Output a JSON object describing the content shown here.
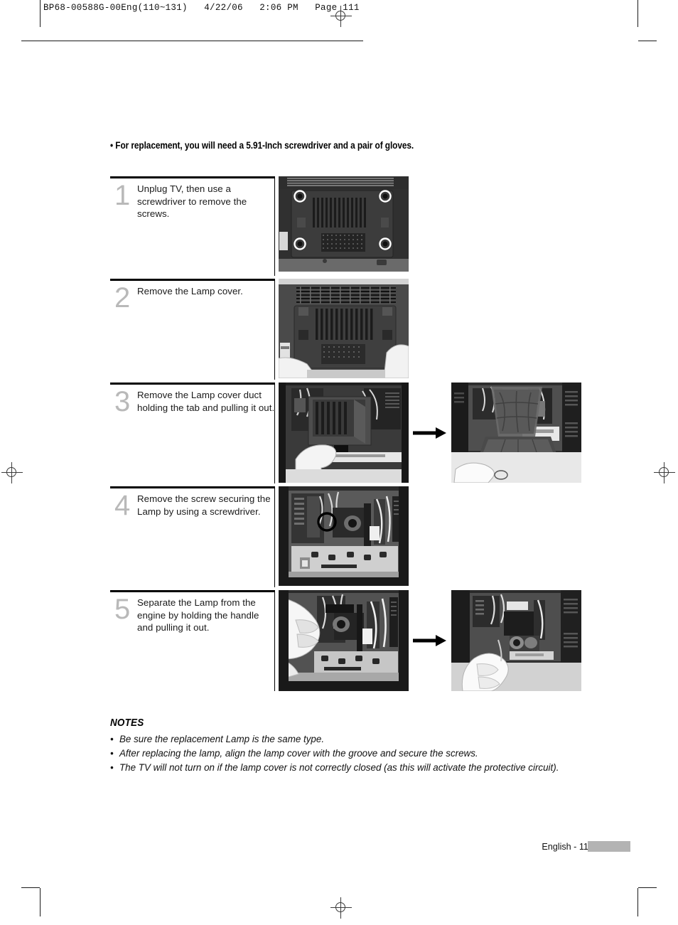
{
  "prepress": {
    "header": "BP68-00588G-00Eng(110~131)   4/22/06   2:06 PM   Page 111"
  },
  "intro": {
    "text": "• For replacement, you will need a 5.91-Inch screwdriver and a pair of gloves."
  },
  "steps": [
    {
      "number": "1",
      "text": "Unplug TV, then use a screwdriver to remove the screws.",
      "figures": 1,
      "arrow": false
    },
    {
      "number": "2",
      "text": "Remove the Lamp cover.",
      "figures": 1,
      "arrow": false
    },
    {
      "number": "3",
      "text": "Remove the Lamp cover duct holding the tab and pulling it out.",
      "figures": 2,
      "arrow": true
    },
    {
      "number": "4",
      "text": "Remove the screw securing the Lamp by using a screwdriver.",
      "figures": 1,
      "arrow": false
    },
    {
      "number": "5",
      "text": "Separate the Lamp from the engine by holding the handle and pulling it out.",
      "figures": 2,
      "arrow": true
    }
  ],
  "notes": {
    "title": "NOTES",
    "bullet": "•",
    "items": [
      "Be sure the replacement Lamp is the same type.",
      "After replacing the lamp, align the lamp cover with the groove and secure the screws.",
      "The TV will not turn on if the lamp cover is not correctly closed (as this will activate the protective circuit)."
    ]
  },
  "footer": {
    "page_label": "English - 111"
  },
  "colors": {
    "step_number": "#b9b9b9",
    "rule": "#000000",
    "footer_bar": "#b3b3b3",
    "text": "#1a1a1a"
  }
}
